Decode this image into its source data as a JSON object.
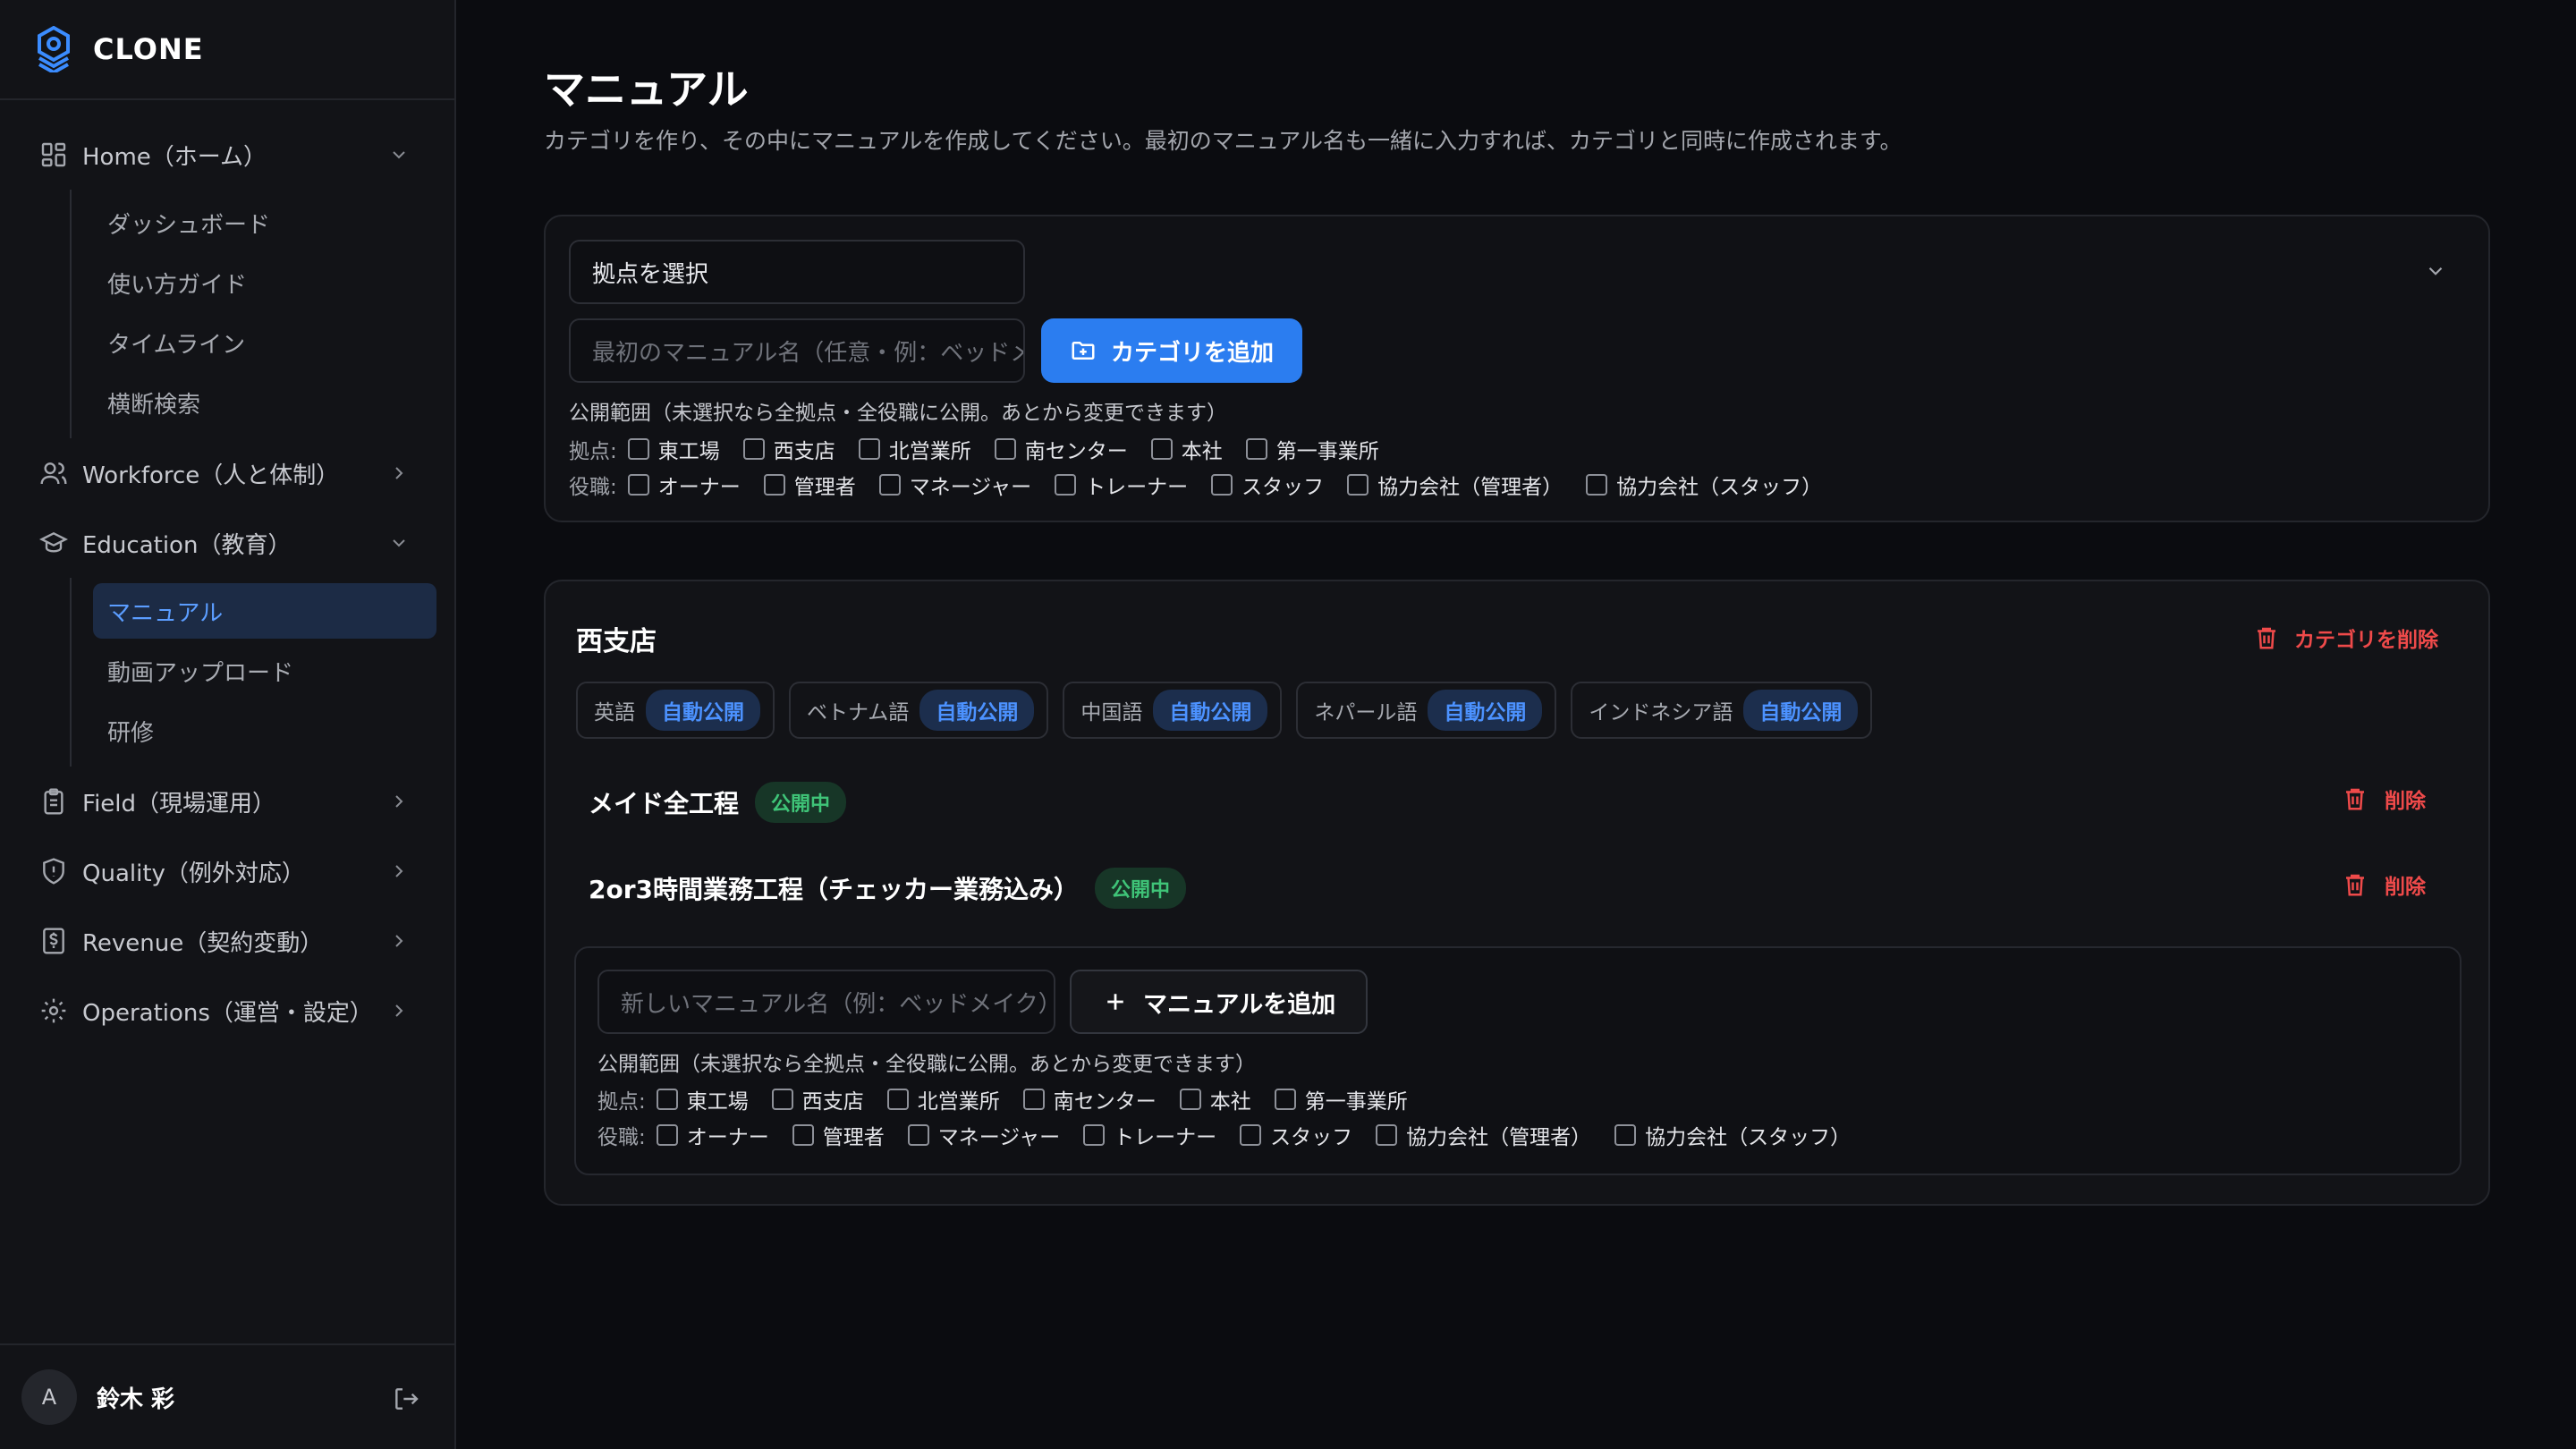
{
  "app": {
    "brand": "CLONE"
  },
  "sidebar": {
    "groups": [
      {
        "label": "Home（ホーム）",
        "icon": "grid-icon",
        "expanded": true,
        "items": [
          "ダッシュボード",
          "使い方ガイド",
          "タイムライン",
          "横断検索"
        ]
      },
      {
        "label": "Workforce（人と体制）",
        "icon": "users-icon",
        "expanded": false
      },
      {
        "label": "Education（教育）",
        "icon": "graduation-cap-icon",
        "expanded": true,
        "items": [
          "マニュアル",
          "動画アップロード",
          "研修"
        ],
        "active_item": "マニュアル"
      },
      {
        "label": "Field（現場運用）",
        "icon": "clipboard-icon",
        "expanded": false
      },
      {
        "label": "Quality（例外対応）",
        "icon": "shield-icon",
        "expanded": false
      },
      {
        "label": "Revenue（契約変動）",
        "icon": "dollar-doc-icon",
        "expanded": false
      },
      {
        "label": "Operations（運営・設定）",
        "icon": "gear-icon",
        "expanded": false
      }
    ],
    "user": {
      "avatar_initial": "A",
      "name": "鈴木 彩"
    }
  },
  "main": {
    "title": "マニュアル",
    "description": "カテゴリを作り、その中にマニュアルを作成してください。最初のマニュアル名も一緒に入力すれば、カテゴリと同時に作成されます。",
    "create_category": {
      "base_select": "拠点を選択",
      "first_manual_placeholder": "最初のマニュアル名（任意・例：ベッドメイク）",
      "add_category_label": "カテゴリを追加",
      "visibility_label": "公開範囲（未選択なら全拠点・全役職に公開。あとから変更できます）",
      "bases_label": "拠点:",
      "bases": [
        "東工場",
        "西支店",
        "北営業所",
        "南センター",
        "本社",
        "第一事業所"
      ],
      "roles_label": "役職:",
      "roles": [
        "オーナー",
        "管理者",
        "マネージャー",
        "トレーナー",
        "スタッフ",
        "協力会社（管理者）",
        "協力会社（スタッフ）"
      ]
    },
    "category": {
      "name": "西支店",
      "delete_label": "カテゴリを削除",
      "languages": [
        {
          "lang": "英語",
          "status": "自動公開"
        },
        {
          "lang": "ベトナム語",
          "status": "自動公開"
        },
        {
          "lang": "中国語",
          "status": "自動公開"
        },
        {
          "lang": "ネパール語",
          "status": "自動公開"
        },
        {
          "lang": "インドネシア語",
          "status": "自動公開"
        }
      ],
      "manuals": [
        {
          "name": "メイド全工程",
          "status": "公開中",
          "delete_label": "削除"
        },
        {
          "name": "2or3時間業務工程（チェッカー業務込み）",
          "status": "公開中",
          "delete_label": "削除"
        }
      ],
      "new_manual": {
        "placeholder": "新しいマニュアル名（例：ベッドメイク）",
        "add_label": "マニュアルを追加",
        "visibility_label": "公開範囲（未選択なら全拠点・全役職に公開。あとから変更できます）",
        "bases_label": "拠点:",
        "bases": [
          "東工場",
          "西支店",
          "北営業所",
          "南センター",
          "本社",
          "第一事業所"
        ],
        "roles_label": "役職:",
        "roles": [
          "オーナー",
          "管理者",
          "マネージャー",
          "トレーナー",
          "スタッフ",
          "協力会社（管理者）",
          "協力会社（スタッフ）"
        ]
      }
    }
  },
  "colors": {
    "accent": "#2b7df0",
    "danger": "#ef4a4a",
    "published": "#3fc478"
  }
}
